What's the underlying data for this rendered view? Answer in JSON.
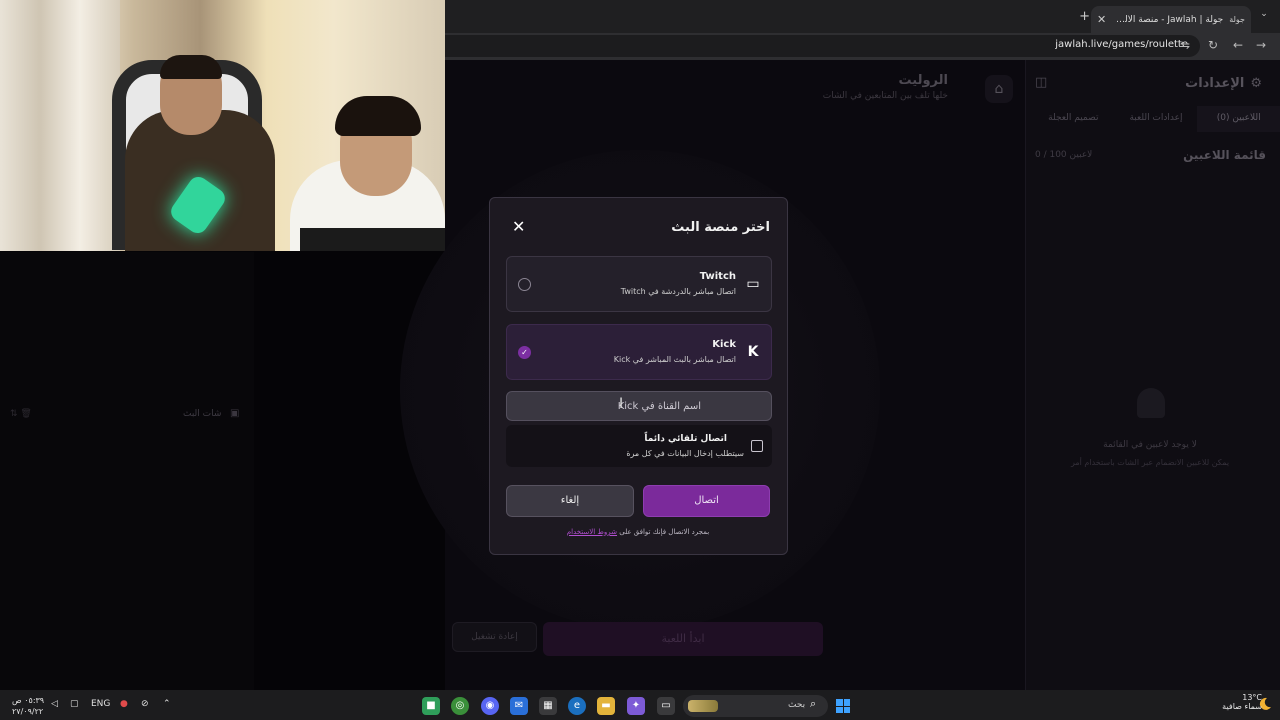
{
  "browser": {
    "tab_title": "جولة | Jawlah - منصة الألعاب الت",
    "tab_favicon": "جولة",
    "new_tab_icon": "plus-icon",
    "url": "jawlah.live/games/roulette"
  },
  "game": {
    "title": "الروليت",
    "subtitle": "خلها تلف بين المتابعين في الشات",
    "start_label": "ابدأ اللعبة",
    "reset_label": "إعادة تشغيل"
  },
  "settings": {
    "title": "الإعدادات",
    "tabs": [
      "اللاعبين (0)",
      "إعدادات اللعبة",
      "تصميم العجلة"
    ],
    "players_title": "قائمة اللاعبين",
    "players_count": "0 / 100 لاعبين",
    "empty_title": "لا يوجد لاعبين في القائمة",
    "empty_subtitle": "يمكن للاعبين الانضمام عبر الشات باستخدام أمر"
  },
  "chat": {
    "title": "شات البث"
  },
  "modal": {
    "title": "اختر منصة البث",
    "options": [
      {
        "name": "Twitch",
        "description": "اتصال مباشر بالدردشة في Twitch",
        "icon": "twitch-icon",
        "selected": false
      },
      {
        "name": "Kick",
        "description": "اتصال مباشر بالبث المباشر في Kick",
        "icon": "kick-icon",
        "selected": true
      }
    ],
    "channel_placeholder": "اسم القناة في Kick",
    "auto_connect_label": "اتصال تلقائي دائماً",
    "auto_connect_desc": "سيتطلب إدخال البيانات في كل مرة",
    "connect_label": "اتصال",
    "cancel_label": "إلغاء",
    "terms_prefix": "بمجرد الاتصال فإنك توافق على",
    "terms_link": "شروط الاستخدام",
    "accent": "#7b2a9b"
  },
  "taskbar": {
    "weather_temp": "13°C",
    "weather_desc": "سماء صافية",
    "search_placeholder": "بحث",
    "lang": "ENG",
    "time": "٠٥:٣٩ ص",
    "date": "٢٧/٠٩/٢٢"
  }
}
